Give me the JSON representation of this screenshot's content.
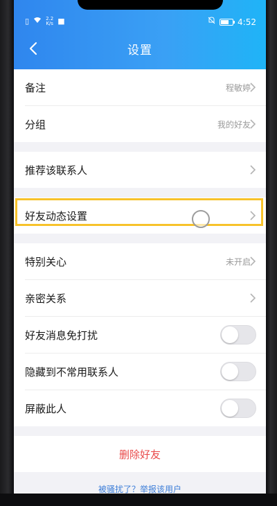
{
  "status_bar": {
    "speed_top": "2.2",
    "speed_bottom": "K/s",
    "time": "4:52"
  },
  "header": {
    "title": "设置"
  },
  "sections": {
    "remark": {
      "label": "备注",
      "value": "程敏婷"
    },
    "group": {
      "label": "分组",
      "value": "我的好友"
    },
    "recommend": {
      "label": "推荐该联系人"
    },
    "moments": {
      "label": "好友动态设置"
    },
    "special_care": {
      "label": "特别关心",
      "value": "未开启"
    },
    "intimate": {
      "label": "亲密关系"
    },
    "mute": {
      "label": "好友消息免打扰",
      "on": false
    },
    "hide": {
      "label": "隐藏到不常用联系人",
      "on": false
    },
    "block": {
      "label": "屏蔽此人",
      "on": false
    }
  },
  "delete_label": "删除好友",
  "report_label": "被骚扰了？举报该用户",
  "colors": {
    "header_start": "#2f86ee",
    "header_end": "#1fb4f7",
    "delete": "#e94b4b",
    "link": "#3d7ed8",
    "highlight": "#f7c22a"
  },
  "icons": [
    "back-arrow-icon",
    "chevron-right-icon",
    "wifi-icon",
    "sim-icon",
    "mute-icon",
    "battery-icon"
  ]
}
